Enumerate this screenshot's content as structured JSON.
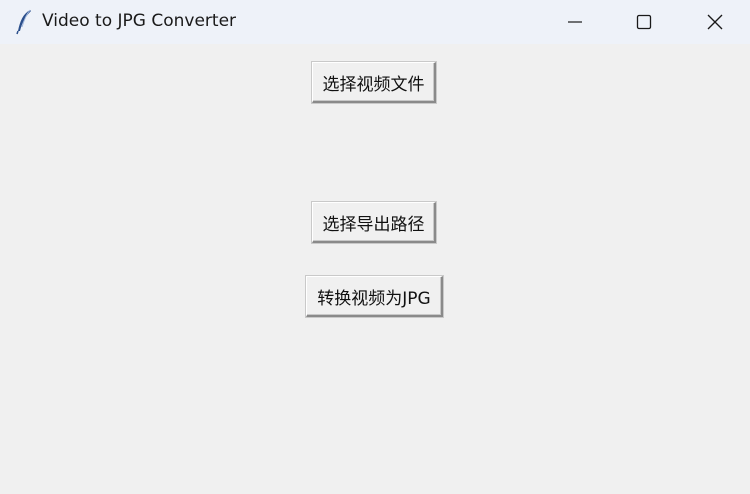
{
  "window": {
    "title": "Video to JPG Converter",
    "icon": "feather-icon",
    "controls": {
      "minimize": "minimize-icon",
      "maximize": "maximize-icon",
      "close": "close-icon"
    }
  },
  "main": {
    "select_file_label": "选择视频文件",
    "select_output_label": "选择导出路径",
    "convert_label": "转换视频为JPG"
  },
  "colors": {
    "titlebar_bg": "#eef2f9",
    "window_bg": "#f0f0f0",
    "button_bg": "#f0f0f0",
    "text": "#111111"
  }
}
